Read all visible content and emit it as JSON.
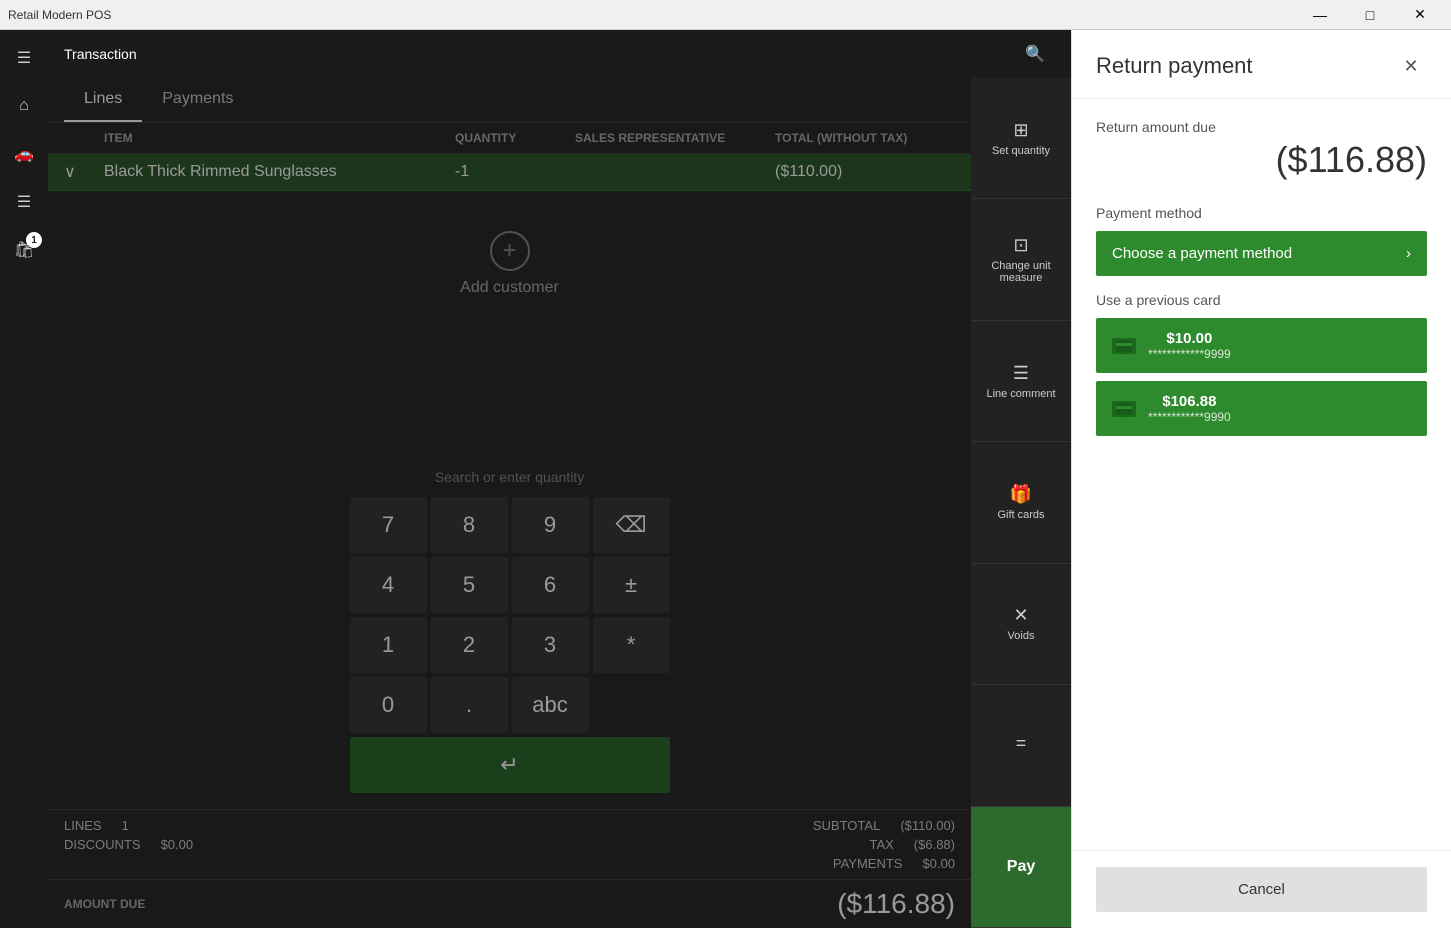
{
  "titleBar": {
    "title": "Retail Modern POS",
    "minimize": "—",
    "maximize": "□",
    "close": "✕"
  },
  "topBar": {
    "title": "Transaction"
  },
  "tabs": [
    {
      "id": "lines",
      "label": "Lines",
      "active": true
    },
    {
      "id": "payments",
      "label": "Payments",
      "active": false
    }
  ],
  "table": {
    "columns": [
      "",
      "ITEM",
      "QUANTITY",
      "SALES REPRESENTATIVE",
      "TOTAL (WITHOUT TAX)"
    ],
    "rows": [
      {
        "item": "Black Thick Rimmed Sunglasses",
        "quantity": "-1",
        "salesRep": "",
        "total": "($110.00)"
      }
    ]
  },
  "addCustomer": {
    "label": "Add customer"
  },
  "numpad": {
    "searchPlaceholder": "Search or enter quantity",
    "keys": [
      "7",
      "8",
      "9",
      "⌫",
      "4",
      "5",
      "6",
      "±",
      "1",
      "2",
      "3",
      "*",
      "0",
      ".",
      "abc"
    ],
    "enterLabel": "↵"
  },
  "totals": {
    "lines": {
      "label": "LINES",
      "value": "1"
    },
    "discounts": {
      "label": "DISCOUNTS",
      "value": "$0.00"
    },
    "subtotal": {
      "label": "SUBTOTAL",
      "value": "($110.00)"
    },
    "tax": {
      "label": "TAX",
      "value": "($6.88)"
    },
    "payments": {
      "label": "PAYMENTS",
      "value": "$0.00"
    },
    "amountDue": {
      "label": "AMOUNT DUE",
      "value": "($116.88)"
    }
  },
  "rightPanel": {
    "buttons": [
      {
        "id": "set-quantity",
        "label": "Set quantity",
        "icon": "⊞"
      },
      {
        "id": "change-unit",
        "label": "Change unit measure",
        "icon": "⊡"
      },
      {
        "id": "line-comment",
        "label": "Line comment",
        "icon": "☰"
      },
      {
        "id": "gift-cards",
        "label": "Gift cards",
        "icon": "🎁"
      },
      {
        "id": "voids",
        "label": "Voids",
        "icon": "✕"
      },
      {
        "id": "totals-btn",
        "label": "",
        "icon": "="
      }
    ],
    "payLabel": "Pay"
  },
  "returnPayment": {
    "title": "Return payment",
    "closeLabel": "✕",
    "amountDueLabel": "Return amount due",
    "amountDueValue": "($116.88)",
    "paymentMethodLabel": "Payment method",
    "choosePaymentLabel": "Choose a payment method",
    "chevron": "›",
    "usePreviousLabel": "Use a previous card",
    "cards": [
      {
        "amount": "$10.00",
        "number": "************9999"
      },
      {
        "amount": "$106.88",
        "number": "************9990"
      }
    ],
    "cancelLabel": "Cancel"
  },
  "sidebar": {
    "menuIcon": "☰",
    "homeIcon": "⌂",
    "cartIcon": "🛒",
    "listIcon": "☰",
    "bagIcon": "👜",
    "badgeNum": "1"
  }
}
